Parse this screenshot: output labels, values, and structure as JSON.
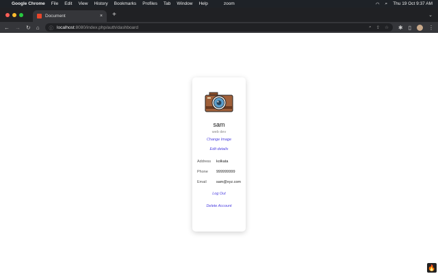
{
  "menubar": {
    "app": "Google Chrome",
    "items": [
      "File",
      "Edit",
      "View",
      "History",
      "Bookmarks",
      "Profiles",
      "Tab",
      "Window",
      "Help"
    ],
    "zoom": "zoom",
    "clock": "Thu 19 Oct 9:37 AM"
  },
  "browser": {
    "tab_title": "Document",
    "url_host": "localhost",
    "url_path": ":8080/index.php/auth/dashboard"
  },
  "profile": {
    "name": "sam",
    "role": "web dev",
    "change_image": "Change Image",
    "edit_details": "Edit details",
    "fields": [
      {
        "label": "Address",
        "value": "kolkata"
      },
      {
        "label": "Phone",
        "value": "999999999"
      },
      {
        "label": "Email",
        "value": "sam@xyz.com"
      }
    ],
    "logout": "Log Out",
    "delete": "Delete Account"
  },
  "colors": {
    "link": "#4b3fe0"
  }
}
